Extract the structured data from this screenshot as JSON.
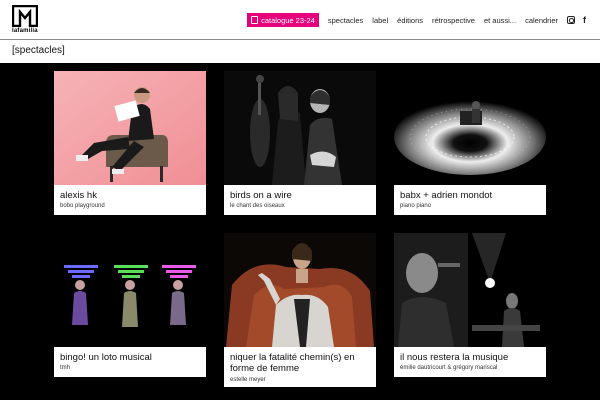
{
  "header": {
    "logo_text": "lafamilia",
    "catalog_label": "catalogue 23-24",
    "nav": [
      "spectacles",
      "label",
      "éditions",
      "rétrospective",
      "et aussi...",
      "calendrier"
    ]
  },
  "page": {
    "title": "[spectacles]"
  },
  "cards": [
    {
      "title": "alexis hk",
      "subtitle": "bobo playground"
    },
    {
      "title": "birds on a wire",
      "subtitle": "le chant des oiseaux"
    },
    {
      "title": "babx + adrien mondot",
      "subtitle": "piano piano"
    },
    {
      "title": "bingo! un loto musical",
      "subtitle": "tmh"
    },
    {
      "title": "niquer la fatalité chemin(s) en forme de femme",
      "subtitle": "estelle meyer"
    },
    {
      "title": "il nous restera la musique",
      "subtitle": "émilie dautricourt & grégory mariscal"
    }
  ],
  "colors": {
    "accent": "#e5007d",
    "background": "#000000"
  }
}
